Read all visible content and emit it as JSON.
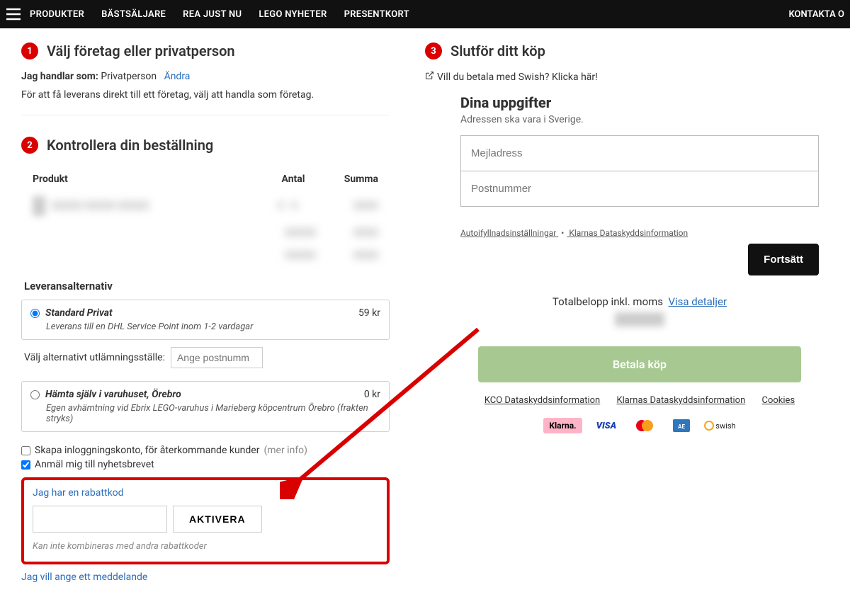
{
  "nav": {
    "items": [
      "PRODUKTER",
      "BÄSTSÄLJARE",
      "REA JUST NU",
      "LEGO NYHETER",
      "PRESENTKORT"
    ],
    "right": "KONTAKTA O"
  },
  "step1": {
    "num": "1",
    "title": "Välj företag eller privatperson",
    "shop_as_label": "Jag handlar som:",
    "shop_as_value": "Privatperson",
    "change": "Ändra",
    "note": "För att få leverans direkt till ett företag, välj att handla som företag."
  },
  "step2": {
    "num": "2",
    "title": "Kontrollera din beställning",
    "th_product": "Produkt",
    "th_qty": "Antal",
    "th_sum": "Summa",
    "delivery_header": "Leveransalternativ",
    "ship1": {
      "name": "Standard Privat",
      "price": "59 kr",
      "desc": "Leverans till en DHL Service Point inom 1-2 vardagar"
    },
    "pickup_label": "Välj alternativt utlämningsställe:",
    "pickup_placeholder": "Ange postnumm",
    "ship2": {
      "name": "Hämta själv i varuhuset, Örebro",
      "price": "0 kr",
      "desc": "Egen avhämtning vid Ebrix LEGO-varuhus i Marieberg köpcentrum Örebro (frakten stryks)"
    },
    "create_account": "Skapa inloggningskonto, för återkommande kunder",
    "more_info": "(mer info)",
    "newsletter": "Anmäl mig till nyhetsbrevet",
    "coupon_link": "Jag har en rabattkod",
    "coupon_btn": "AKTIVERA",
    "coupon_note": "Kan inte kombineras med andra rabattkoder",
    "msg_link": "Jag vill ange ett meddelande"
  },
  "step3": {
    "num": "3",
    "title": "Slutför ditt köp",
    "swish_line": "Vill du betala med Swish? Klicka här!",
    "k_title": "Dina uppgifter",
    "k_sub": "Adressen ska vara i Sverige.",
    "email_ph": "Mejladress",
    "zip_ph": "Postnummer",
    "autofill": "Autoifyllnadsinställningar",
    "privacy": "Klarnas Dataskyddsinformation",
    "continue": "Fortsätt",
    "total_label": "Totalbelopp inkl. moms",
    "show_details": "Visa detaljer",
    "pay_btn": "Betala köp",
    "links": {
      "kco": "KCO Dataskyddsinformation",
      "klarna": "Klarnas Dataskyddsinformation",
      "cookies": "Cookies"
    },
    "badges": {
      "klarna": "Klarna.",
      "visa": "VISA",
      "swish": "swish"
    }
  }
}
